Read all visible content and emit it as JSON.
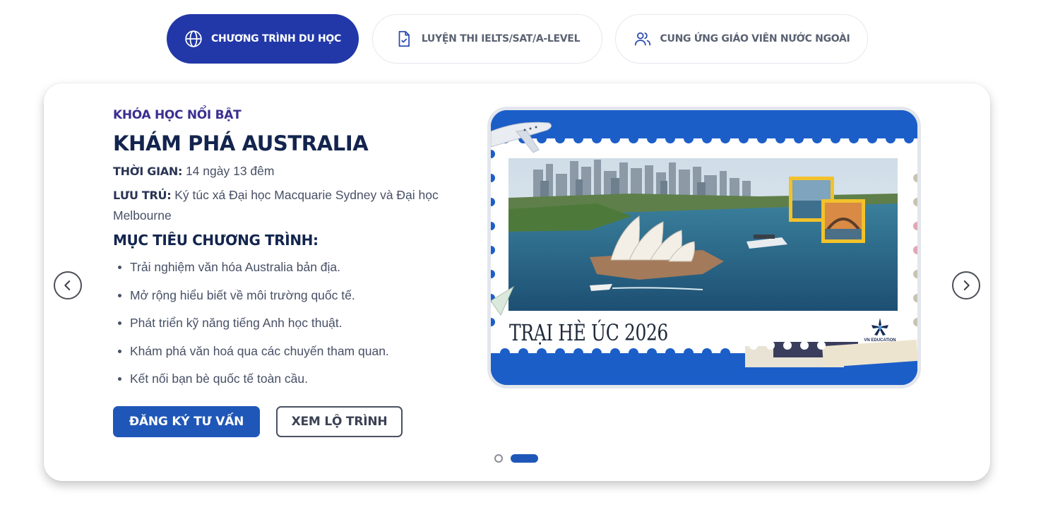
{
  "tabs": [
    {
      "label": "CHƯƠNG TRÌNH DU HỌC",
      "icon": "globe-icon",
      "active": true
    },
    {
      "label": "LUYỆN THI IELTS/SAT/A-LEVEL",
      "icon": "document-check-icon",
      "active": false
    },
    {
      "label": "CUNG ỨNG GIÁO VIÊN NƯỚC NGOÀI",
      "icon": "users-icon",
      "active": false
    }
  ],
  "course": {
    "eyebrow": "KHÓA HỌC NỔI BẬT",
    "title": "KHÁM PHÁ AUSTRALIA",
    "duration_label": "THỜI GIAN:",
    "duration_value": "14 ngày 13 đêm",
    "stay_label": "LƯU TRÚ:",
    "stay_value": "Ký túc xá Đại học Macquarie Sydney và Đại học Melbourne",
    "goals_title": "MỤC TIÊU CHƯƠNG TRÌNH:",
    "goals": [
      "Trải nghiệm văn hóa Australia bản địa.",
      "Mở rộng hiểu biết về môi trường quốc tế.",
      "Phát triển kỹ năng tiếng Anh học thuật.",
      "Khám phá văn hoá qua các chuyến tham quan.",
      "Kết nối bạn bè quốc tế toàn cầu."
    ],
    "register_button": "ĐĂNG KÝ TƯ VẤN",
    "roadmap_button": "XEM LỘ TRÌNH"
  },
  "banner": {
    "caption": "TRẠI HÈ ÚC 2026",
    "logo_text": "VN EDUCATION"
  },
  "carousel": {
    "prev_icon": "chevron-left-icon",
    "next_icon": "chevron-right-icon",
    "slide_count": 2,
    "active_slide": 2
  },
  "colors": {
    "primary": "#2238a8",
    "button_blue": "#1f57b8",
    "heading": "#13254e",
    "eyebrow": "#3a2f8f",
    "body_text": "#475066"
  }
}
